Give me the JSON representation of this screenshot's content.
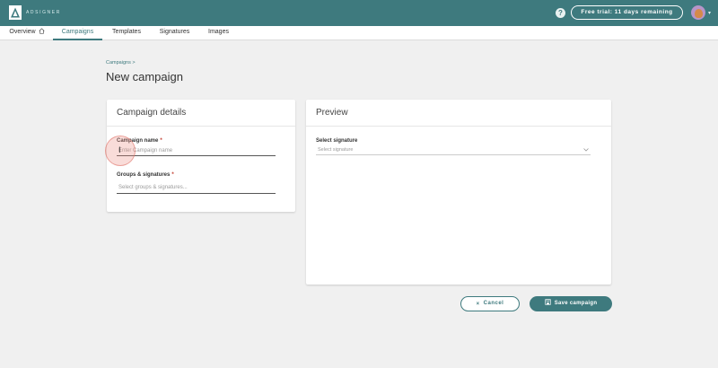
{
  "header": {
    "brand": "ADSIGNER",
    "help_label": "?",
    "trial_label": "Free trial: 11 days remaining"
  },
  "nav": {
    "items": [
      {
        "label": "Overview"
      },
      {
        "label": "Campaigns",
        "active": true
      },
      {
        "label": "Templates"
      },
      {
        "label": "Signatures"
      },
      {
        "label": "Images"
      }
    ]
  },
  "page": {
    "breadcrumb": "Campaigns >",
    "title": "New campaign"
  },
  "details_card": {
    "title": "Campaign details",
    "name_label": "Campaign name",
    "name_placeholder": "Enter Campaign name",
    "groups_label": "Groups & signatures",
    "groups_placeholder": "Select groups & signatures...",
    "required_mark": "*"
  },
  "preview_card": {
    "title": "Preview",
    "signature_label": "Select signature",
    "signature_placeholder": "Select signature"
  },
  "actions": {
    "cancel_label": "Cancel",
    "cancel_icon": "×",
    "save_label": "Save campaign"
  },
  "colors": {
    "accent": "#3e7a7e",
    "required": "#c0392b"
  },
  "icons": {
    "logo": "adsigner-logo",
    "home": "home-icon",
    "close": "close-icon",
    "save": "save-icon",
    "chevron": "chevron-down-icon"
  }
}
